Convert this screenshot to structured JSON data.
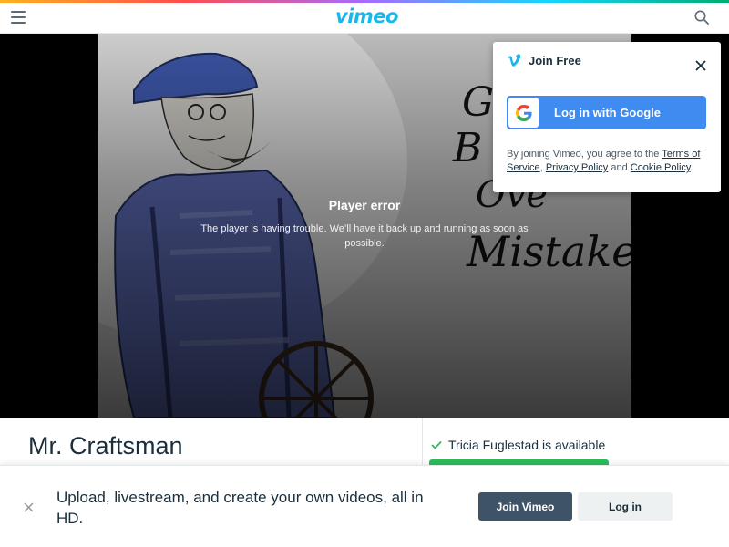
{
  "header": {
    "logo": "vimeo",
    "menu_icon": "hamburger-menu-icon",
    "search_icon": "search-icon",
    "accent_color": "#1ab7ea"
  },
  "player": {
    "error_title": "Player error",
    "error_message": "The player is having trouble. We’ll have it back up and running as soon as possible."
  },
  "join_popup": {
    "title": "Join Free",
    "google_button": "Log in with Google",
    "legal_prefix": "By joining Vimeo, you agree to the ",
    "terms_link": "Terms of Service",
    "comma": ", ",
    "privacy_link": "Privacy Policy",
    "and_text": " and ",
    "cookie_link": "Cookie Policy",
    "period": ".",
    "google_color": "#3f8bf0"
  },
  "video": {
    "title": "Mr. Craftsman",
    "availability": "Tricia Fuglestad is available",
    "status_color": "#2bbd5a"
  },
  "banner": {
    "text": "Upload, livestream, and create your own videos, all in HD.",
    "join_button": "Join Vimeo",
    "login_button": "Log in",
    "join_color": "#3f5366"
  }
}
